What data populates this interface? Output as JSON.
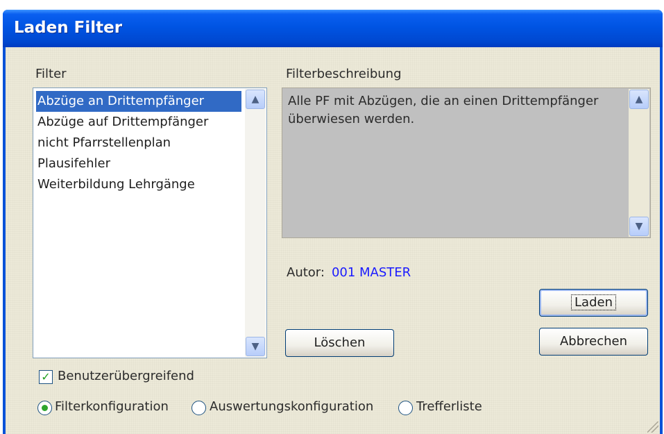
{
  "window": {
    "title": "Laden Filter"
  },
  "filter": {
    "label": "Filter",
    "items": [
      "Abzüge an Drittempfänger",
      "Abzüge auf Drittempfänger",
      "nicht Pfarrstellenplan",
      "Plausifehler",
      "Weiterbildung Lehrgänge"
    ],
    "selected_index": 0
  },
  "description": {
    "label": "Filterbeschreibung",
    "text_line1": "Alle PF mit Abzügen, die an einen Drittempfänger",
    "text_line2": "überwiesen werden."
  },
  "author": {
    "label": "Autor:",
    "value": "001 MASTER",
    "value_color": "#1a1aff"
  },
  "buttons": {
    "load": "Laden",
    "delete": "Löschen",
    "cancel": "Abbrechen"
  },
  "options": {
    "cross_user_label": "Benutzerübergreifend",
    "cross_user_checked": true,
    "radio_filter_config": "Filterkonfiguration",
    "radio_evaluation_config": "Auswertungskonfiguration",
    "radio_hit_list": "Trefferliste",
    "selected_radio": "Filterkonfiguration"
  },
  "colors": {
    "titlebar": "#0054e3",
    "selection": "#316ac5",
    "dialog_bg": "#ece9d8"
  },
  "icons": {
    "scroll_up": "chevron-up-icon",
    "scroll_down": "chevron-down-icon",
    "check": "check-icon"
  }
}
